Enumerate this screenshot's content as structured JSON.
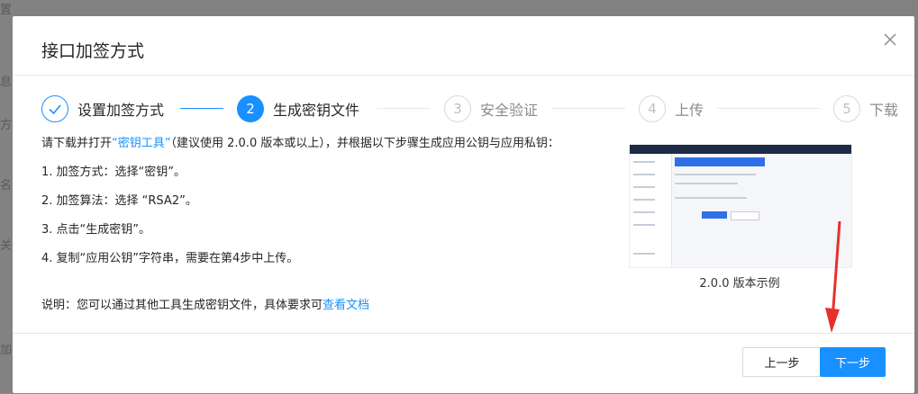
{
  "background": {
    "fragments": [
      "置",
      "息",
      "方式",
      "名",
      "关",
      "加"
    ]
  },
  "dialog": {
    "title": "接口加签方式",
    "close_icon": "close-icon",
    "steps": [
      {
        "number": "1",
        "label": "设置加签方式",
        "status": "done"
      },
      {
        "number": "2",
        "label": "生成密钥文件",
        "status": "active"
      },
      {
        "number": "3",
        "label": "安全验证",
        "status": "wait"
      },
      {
        "number": "4",
        "label": "上传",
        "status": "wait"
      },
      {
        "number": "5",
        "label": "下载",
        "status": "wait"
      }
    ],
    "intro": {
      "before": "请下载并打开",
      "link": "“密钥工具”",
      "after": "（建议使用 2.0.0 版本或以上），并根据以下步骤生成应用公钥与应用私钥："
    },
    "instructions": [
      "1. 加签方式：选择“密钥”。",
      "2. 加签算法：选择 “RSA2”。",
      "3. 点击“生成密钥”。",
      "4. 复制“应用公钥”字符串，需要在第4步中上传。"
    ],
    "note": {
      "before": "说明：您可以通过其他工具生成密钥文件，具体要求可",
      "link": "查看文档"
    },
    "example_caption": "2.0.0 版本示例",
    "buttons": {
      "prev": "上一步",
      "next": "下一步"
    }
  },
  "colors": {
    "primary": "#1890ff",
    "text": "#262626",
    "muted": "#8c8c8c",
    "annotation_arrow": "#e8302a"
  }
}
